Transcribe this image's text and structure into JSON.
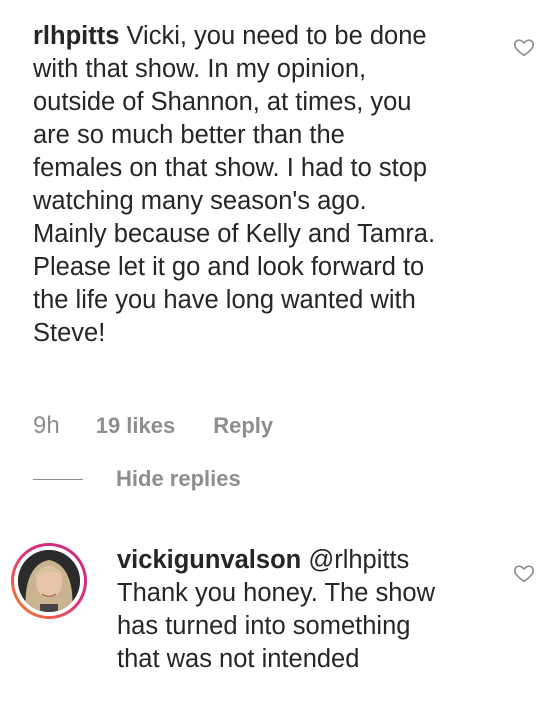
{
  "comment": {
    "username": "rlhpitts",
    "lines": [
      " Vicki, you need to be done",
      "with that show. In my opinion,",
      "outside of Shannon, at times, you",
      "are so much better than the",
      "females on that show. I had to stop",
      "watching many season's ago.",
      "Mainly because of Kelly and Tamra.",
      "Please let it go and look forward to",
      "the life you have long wanted with",
      "Steve!"
    ],
    "time": "9h",
    "likes": "19 likes",
    "reply_label": "Reply"
  },
  "hide_replies_label": "Hide replies",
  "reply": {
    "username": "vickigunvalson",
    "mention": " @rlhpitts",
    "lines": [
      "Thank you honey. The show",
      "has turned into something",
      "that was not intended"
    ]
  },
  "icons": {
    "like": "heart-outline-icon"
  }
}
